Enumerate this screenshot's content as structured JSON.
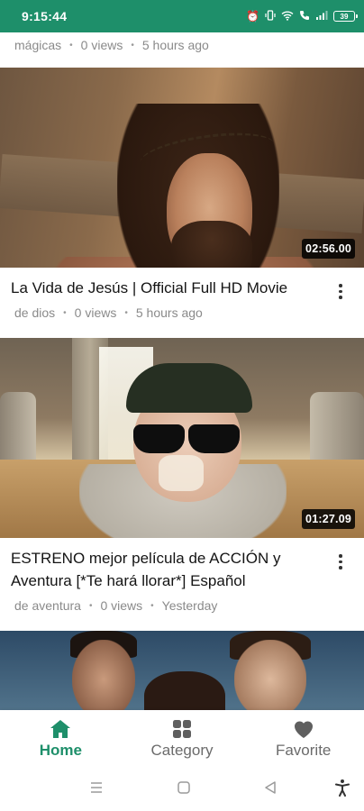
{
  "status_bar": {
    "time": "9:15:44",
    "battery": "39",
    "icons": [
      "alarm-icon",
      "vibrate-icon",
      "wifi-icon",
      "call-icon",
      "signal-icon",
      "battery-icon"
    ]
  },
  "feed": {
    "top_meta": {
      "channel": "mágicas",
      "views": "0 views",
      "time": "5 hours ago"
    },
    "videos": [
      {
        "duration": "02:56.00",
        "title": "La Vida de Jesús | Official Full HD Movie",
        "channel": "de dios",
        "views": "0 views",
        "time": "5 hours ago"
      },
      {
        "duration": "01:27.09",
        "title": "ESTRENO mejor película de ACCIÓN y Aventura [*Te hará llorar*] Español",
        "channel": "de aventura",
        "views": "0 views",
        "time": "Yesterday"
      }
    ]
  },
  "bottom_nav": {
    "items": [
      {
        "label": "Home",
        "icon": "home-icon",
        "active": true
      },
      {
        "label": "Category",
        "icon": "grid-icon",
        "active": false
      },
      {
        "label": "Favorite",
        "icon": "heart-icon",
        "active": false
      }
    ]
  },
  "colors": {
    "accent": "#1e8f6a",
    "status_bar": "#1e8f6a",
    "meta_text": "#8a8a8a",
    "inactive_nav": "#6b6b6b"
  }
}
